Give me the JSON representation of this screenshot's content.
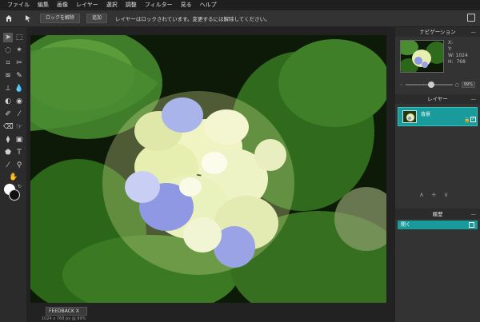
{
  "menu": [
    "ファイル",
    "編集",
    "画像",
    "レイヤー",
    "選択",
    "調整",
    "フィルター",
    "見る",
    "ヘルプ"
  ],
  "toolbar": {
    "unlock_label": "ロックを解除",
    "add_label": "追加",
    "message": "レイヤーはロックされています。変更するには解除してください。"
  },
  "navigation": {
    "title": "ナビゲーション",
    "x_label": "X:",
    "y_label": "Y:",
    "w_label": "W:",
    "w_value": "1024",
    "h_label": "H:",
    "h_value": "768",
    "zoom": "99%"
  },
  "layers": {
    "title": "レイヤー",
    "items": [
      {
        "name": "背景"
      }
    ]
  },
  "history": {
    "title": "履歴",
    "items": [
      {
        "label": "開く"
      }
    ]
  },
  "feedback_label": "FEEDBACK   X",
  "status_text": "1024 x 768 px @ 99%",
  "colors": {
    "accent": "#1a9b9b",
    "foreground": "#ffffff",
    "background": "#111111"
  }
}
